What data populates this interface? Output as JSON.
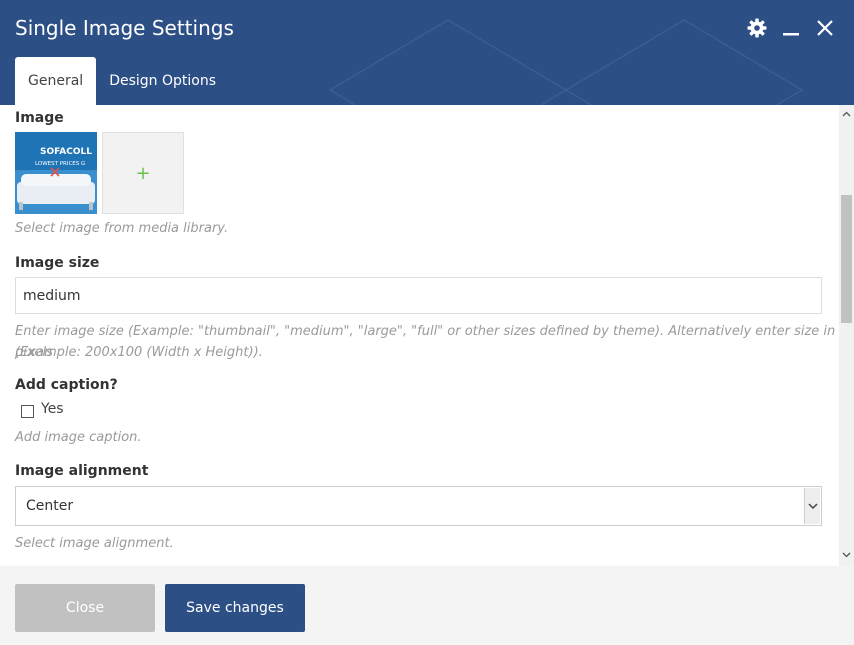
{
  "modal": {
    "title": "Single Image Settings",
    "colors": {
      "header": "#2c4f86",
      "accent_plus": "#6bbf4e"
    },
    "header_icons": [
      "gear-icon",
      "minimize-icon",
      "close-icon"
    ]
  },
  "tabs": [
    {
      "label": "General",
      "active": true
    },
    {
      "label": "Design Options",
      "active": false
    }
  ],
  "image_field": {
    "label": "Image",
    "thumbnail_brand_text": "SOFACOLL",
    "thumbnail_sub_text": "LOWEST PRICES G",
    "add_symbol": "+",
    "help": "Select image from media library."
  },
  "image_size": {
    "label": "Image size",
    "value": "medium",
    "help_line1": "Enter image size (Example: \"thumbnail\", \"medium\", \"large\", \"full\" or other sizes defined by theme). Alternatively enter size in pixels",
    "help_line2": "(Example: 200x100 (Width x Height))."
  },
  "caption": {
    "label": "Add caption?",
    "checkbox_label": "Yes",
    "checked": false,
    "help": "Add image caption."
  },
  "alignment": {
    "label": "Image alignment",
    "selected": "Center",
    "help": "Select image alignment."
  },
  "footer": {
    "close_label": "Close",
    "save_label": "Save changes"
  }
}
